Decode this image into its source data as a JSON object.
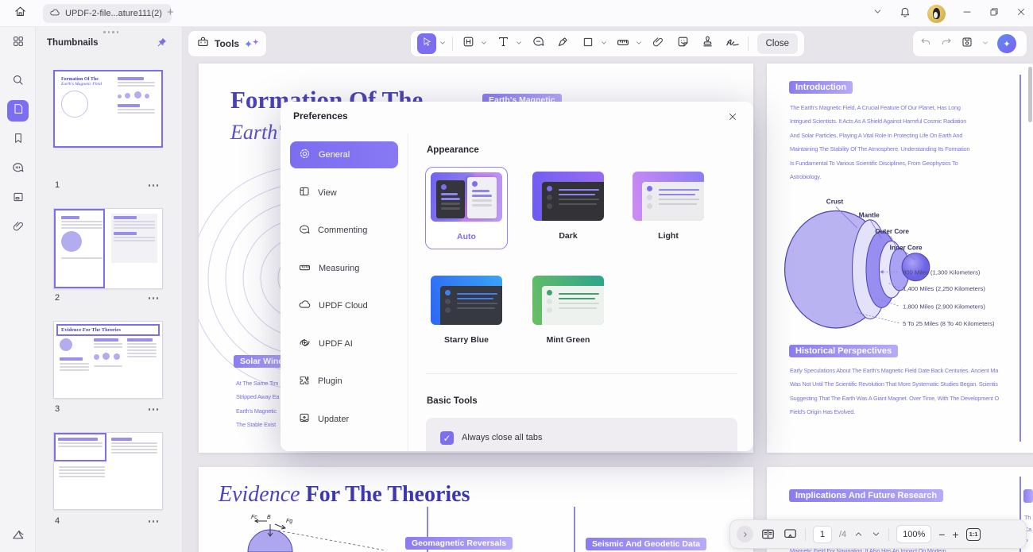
{
  "window": {
    "tab_title": "UPDF-2-file...ature111(2)"
  },
  "thumbnails": {
    "header": "Thumbnails",
    "pages": [
      {
        "num": "1"
      },
      {
        "num": "2"
      },
      {
        "num": "3"
      },
      {
        "num": "4"
      }
    ],
    "page1_title": "Formation Of The",
    "page1_subtitle": "Earth's Magnetic Field",
    "page3_title": "Evidence For The Theories"
  },
  "toolbar": {
    "tools": "Tools",
    "close": "Close"
  },
  "dialog": {
    "title": "Preferences",
    "nav": [
      {
        "label": "General"
      },
      {
        "label": "View"
      },
      {
        "label": "Commenting"
      },
      {
        "label": "Measuring"
      },
      {
        "label": "UPDF Cloud"
      },
      {
        "label": "UPDF AI"
      },
      {
        "label": "Plugin"
      },
      {
        "label": "Updater"
      }
    ],
    "appearance_heading": "Appearance",
    "themes": [
      {
        "label": "Auto"
      },
      {
        "label": "Dark"
      },
      {
        "label": "Light"
      },
      {
        "label": "Starry Blue"
      },
      {
        "label": "Mint Green"
      }
    ],
    "basic_tools_heading": "Basic Tools",
    "always_close_label": "Always close all tabs"
  },
  "page1": {
    "title": "Formation Of The",
    "subtitle": "Earth's Magnetic Field",
    "heading_badge": "Earth's Magnetic",
    "solar_badge": "Solar Wind",
    "solar_lines": [
      "At The Same Tim",
      "Stripped Away Ea",
      "Earth's Magnetic",
      "The Stable Exist"
    ]
  },
  "page2": {
    "intro_badge": "Introduction",
    "intro_lines": [
      "The Earth's Magnetic Field, A Crucial Feature Of Our Planet, Has Long",
      "Intrigued Scientists. It Acts As A Shield Against Harmful Cosmic Radiation",
      "And Solar Particles, Playing A Vital Role In Protecting Life On Earth And",
      "Maintaining The Stability Of The Atmosphere. Understanding Its Formation",
      "Is Fundamental To Various Scientific Disciplines, From Geophysics To",
      "Astrobiology."
    ],
    "diagram": {
      "labels": [
        "Crust",
        "Mantle",
        "Outer Core",
        "Inner Core"
      ],
      "measurements": [
        "800 Miles (1,300 Kilometers)",
        "1,400 Miles (2,250 Kilometers)",
        "1,800 Miles (2,900 Kilometers)",
        "5 To 25 Miles (8 To 40 Kilometers)"
      ]
    },
    "hist_badge": "Historical Perspectives",
    "hist_lines": [
      "Early Speculations About The Earth's Magnetic Field Date Back Centuries. Ancient Ma",
      "Was Not Until The Scientific Revolution That More Systematic Studies Began. Scientis",
      "Suggesting That The Earth Was A Giant Magnet. Over Time, With The Development O",
      "Field's Origin Has Evolved."
    ]
  },
  "page3": {
    "title_italic": "Evidence",
    "title_rest": " For The Theories",
    "badge_reversals": "Geomagnetic Reversals",
    "badge_seismic": "Seismic And Geodetic Data",
    "fc": "Fc",
    "b": "B",
    "fg": "Fg"
  },
  "page4": {
    "badge": "Implications And Future Research",
    "partial_line": "Magnetic Field For Navigation, It Also Has An Impact On Modern",
    "edge_lines": [
      "Th",
      "Ca",
      "P"
    ]
  },
  "pager": {
    "page": "1",
    "total": "/4",
    "zoom": "100%",
    "ratio": "1:1"
  }
}
